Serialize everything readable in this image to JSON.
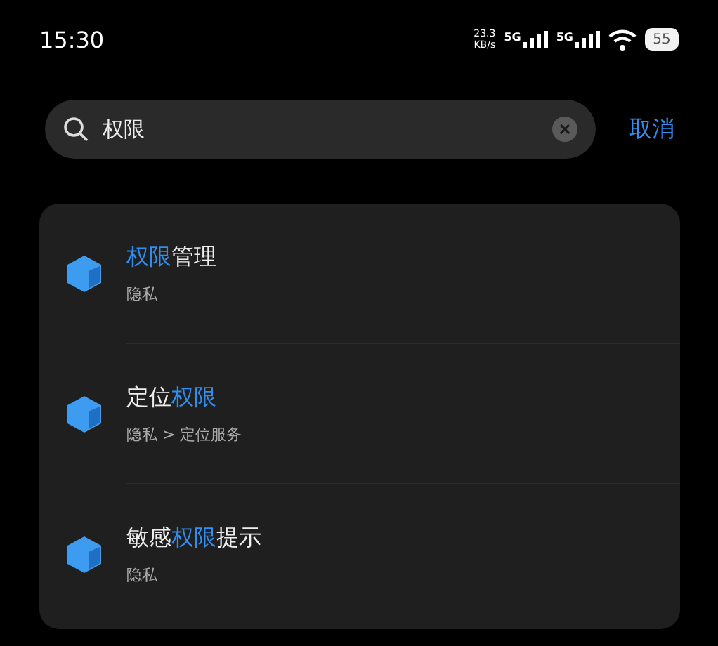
{
  "status_bar": {
    "time": "15:30",
    "speed": "23.3",
    "speed_unit": "KB/s",
    "networks": [
      "5G",
      "5G"
    ],
    "battery": "55"
  },
  "search": {
    "value": "权限",
    "cancel": "取消"
  },
  "results": [
    {
      "title": [
        {
          "text": "权限",
          "highlight": true
        },
        {
          "text": "管理",
          "highlight": false
        }
      ],
      "path": "隐私"
    },
    {
      "title": [
        {
          "text": "定位",
          "highlight": false
        },
        {
          "text": "权限",
          "highlight": true
        }
      ],
      "path": "隐私 > 定位服务"
    },
    {
      "title": [
        {
          "text": "敏感",
          "highlight": false
        },
        {
          "text": "权限",
          "highlight": true
        },
        {
          "text": "提示",
          "highlight": false
        }
      ],
      "path": "隐私"
    }
  ]
}
